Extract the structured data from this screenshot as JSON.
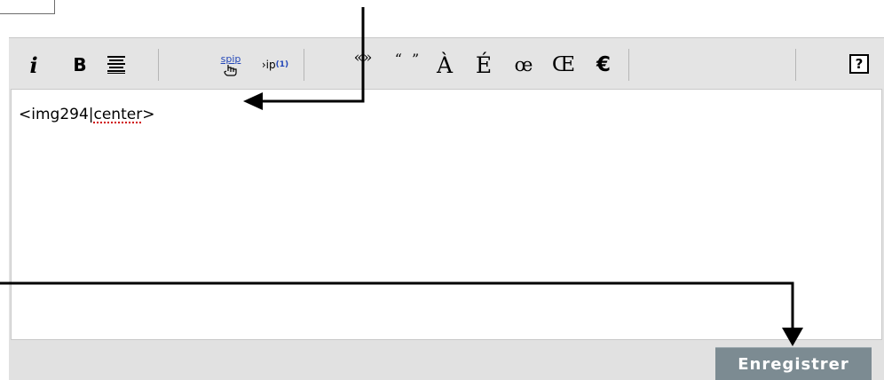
{
  "toolbar": {
    "italic": "i",
    "bold": "B",
    "spip_link": "spip",
    "spip_footnote_prefix": "›ip",
    "spip_footnote_sup": "(1)",
    "french_quotes": "«»",
    "english_quotes": "“ ”",
    "a_grave": "À",
    "e_acute": "É",
    "oe_ligature": "œ",
    "OE_ligature": "Œ",
    "euro": "€",
    "help": "?"
  },
  "editor": {
    "text_prefix": "<img294|",
    "text_misspelled": "center",
    "text_suffix": ">"
  },
  "actions": {
    "save_label": "Enregistrer"
  },
  "colors": {
    "save_button": "#7c8b92",
    "toolbar": "#e4e4e4",
    "annotation_arrows": "#000000"
  }
}
